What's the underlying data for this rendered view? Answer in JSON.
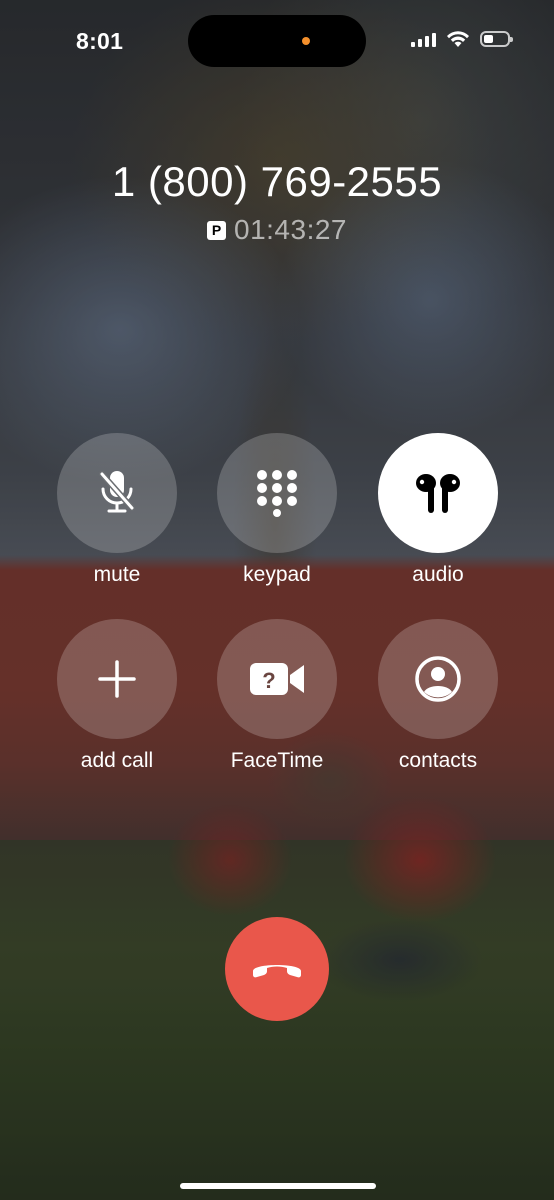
{
  "status_bar": {
    "time": "8:01",
    "icons": [
      "signal-icon",
      "wifi-icon",
      "battery-icon"
    ],
    "privacy_indicator_color": "#f4902c"
  },
  "call": {
    "number": "1 (800) 769-2555",
    "badge": "P",
    "duration": "01:43:27"
  },
  "controls": [
    {
      "label": "mute",
      "icon": "mic-slash-icon",
      "active": false
    },
    {
      "label": "keypad",
      "icon": "keypad-icon",
      "active": false
    },
    {
      "label": "audio",
      "icon": "airpods-icon",
      "active": true
    },
    {
      "label": "add call",
      "icon": "plus-icon",
      "active": false
    },
    {
      "label": "FaceTime",
      "icon": "facetime-icon",
      "active": false
    },
    {
      "label": "contacts",
      "icon": "contact-icon",
      "active": false
    }
  ],
  "end_call": {
    "icon": "phone-hangup-icon",
    "color": "#e9574b"
  }
}
